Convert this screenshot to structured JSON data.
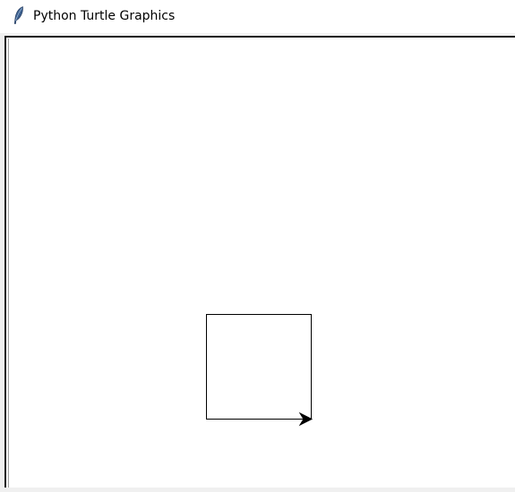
{
  "window": {
    "title": "Python Turtle Graphics",
    "title_icon": "feather-icon"
  },
  "canvas": {
    "background": "#ffffff",
    "pen_color": "#000000",
    "shapes": [
      {
        "type": "square",
        "label": "drawn-square"
      }
    ],
    "turtle": {
      "shape": "arrow",
      "heading": "east",
      "icon": "turtle-arrow-icon"
    }
  }
}
